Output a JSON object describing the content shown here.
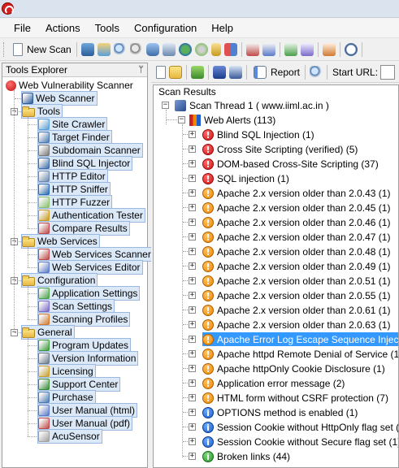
{
  "menu": [
    "File",
    "Actions",
    "Tools",
    "Configuration",
    "Help"
  ],
  "toolbar": {
    "new_scan_label": "New Scan"
  },
  "tools_explorer": {
    "title": "Tools Explorer",
    "pin": "ᛘ",
    "root": "Web Vulnerability Scanner",
    "web_scanner": "Web Scanner",
    "groups": [
      {
        "label": "Tools",
        "items": [
          "Site Crawler",
          "Target Finder",
          "Subdomain Scanner",
          "Blind SQL Injector",
          "HTTP Editor",
          "HTTP Sniffer",
          "HTTP Fuzzer",
          "Authentication Tester",
          "Compare Results"
        ]
      },
      {
        "label": "Web Services",
        "items": [
          "Web Services Scanner",
          "Web Services Editor"
        ]
      },
      {
        "label": "Configuration",
        "items": [
          "Application Settings",
          "Scan Settings",
          "Scanning Profiles"
        ]
      },
      {
        "label": "General",
        "items": [
          "Program Updates",
          "Version Information",
          "Licensing",
          "Support Center",
          "Purchase",
          "User Manual (html)",
          "User Manual (pdf)",
          "AcuSensor"
        ]
      }
    ]
  },
  "right_toolbar": {
    "report_label": "Report",
    "start_url_label": "Start URL:"
  },
  "scan_results": {
    "title": "Scan Results",
    "thread": "Scan Thread 1 ( www.iiml.ac.in )",
    "web_alerts": "Web Alerts (113)",
    "alerts": [
      {
        "label": "Blind SQL Injection (1)",
        "severity": "high"
      },
      {
        "label": "Cross Site Scripting (verified) (5)",
        "severity": "high"
      },
      {
        "label": "DOM-based Cross-Site Scripting (37)",
        "severity": "high"
      },
      {
        "label": "SQL injection (1)",
        "severity": "high"
      },
      {
        "label": "Apache 2.x version older than 2.0.43 (1)",
        "severity": "medium"
      },
      {
        "label": "Apache 2.x version older than 2.0.45 (1)",
        "severity": "medium"
      },
      {
        "label": "Apache 2.x version older than 2.0.46 (1)",
        "severity": "medium"
      },
      {
        "label": "Apache 2.x version older than 2.0.47 (1)",
        "severity": "medium"
      },
      {
        "label": "Apache 2.x version older than 2.0.48 (1)",
        "severity": "medium"
      },
      {
        "label": "Apache 2.x version older than 2.0.49 (1)",
        "severity": "medium"
      },
      {
        "label": "Apache 2.x version older than 2.0.51 (1)",
        "severity": "medium"
      },
      {
        "label": "Apache 2.x version older than 2.0.55 (1)",
        "severity": "medium"
      },
      {
        "label": "Apache 2.x version older than 2.0.61 (1)",
        "severity": "medium"
      },
      {
        "label": "Apache 2.x version older than 2.0.63 (1)",
        "severity": "medium"
      },
      {
        "label": "Apache Error Log Escape Sequence Injection V",
        "severity": "medium",
        "selected": true
      },
      {
        "label": "Apache httpd Remote Denial of Service (1)",
        "severity": "medium"
      },
      {
        "label": "Apache httpOnly Cookie Disclosure (1)",
        "severity": "medium"
      },
      {
        "label": "Application error message (2)",
        "severity": "medium"
      },
      {
        "label": "HTML form without CSRF protection (7)",
        "severity": "medium"
      },
      {
        "label": "OPTIONS method is enabled (1)",
        "severity": "low"
      },
      {
        "label": "Session Cookie without HttpOnly flag set (1)",
        "severity": "low"
      },
      {
        "label": "Session Cookie without Secure flag set (1)",
        "severity": "low"
      },
      {
        "label": "Broken links (44)",
        "severity": "info"
      }
    ]
  },
  "colors": {
    "selection": "#3399ff",
    "high": "#d01414",
    "medium": "#ee8800",
    "low": "#1e5fd0",
    "info": "#2a9a2a"
  }
}
